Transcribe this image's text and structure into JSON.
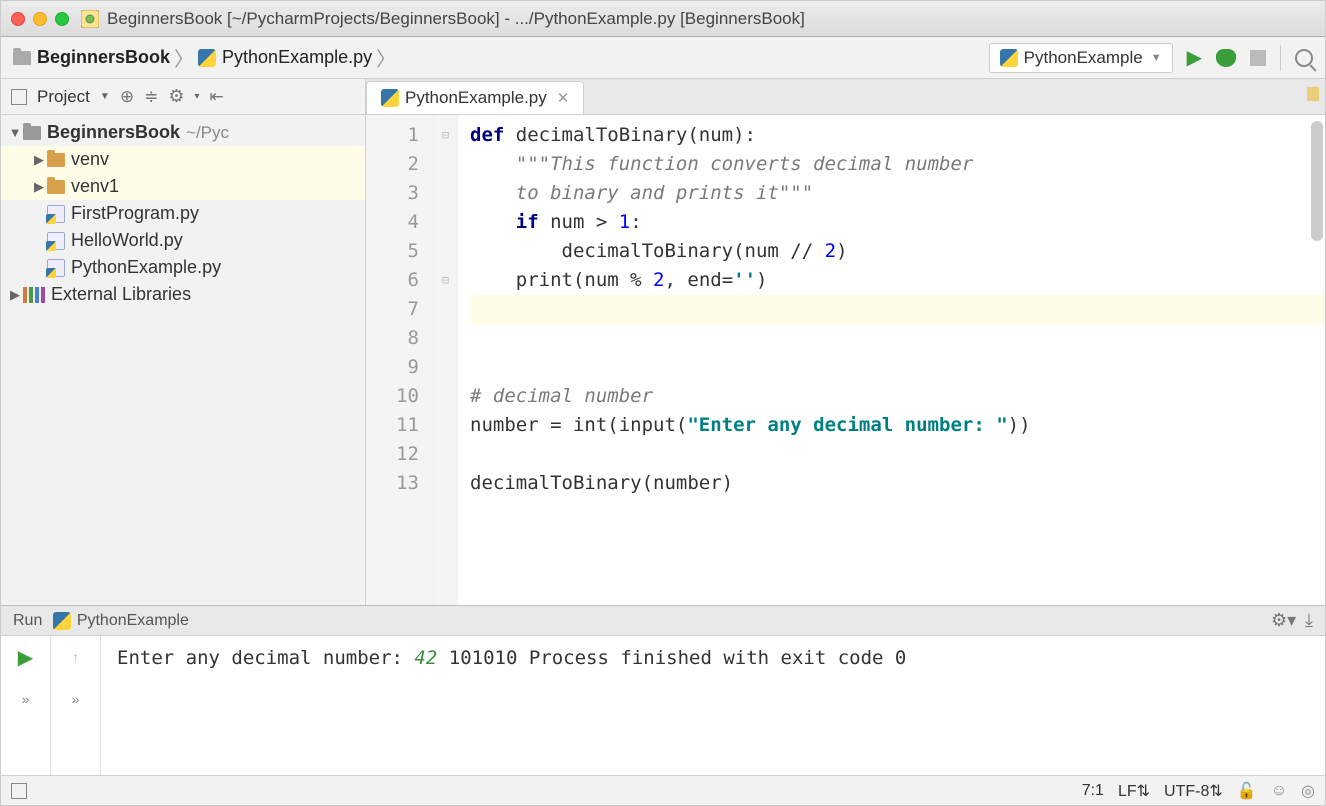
{
  "title": "BeginnersBook [~/PycharmProjects/BeginnersBook] - .../PythonExample.py [BeginnersBook]",
  "breadcrumb": {
    "root": "BeginnersBook",
    "file": "PythonExample.py"
  },
  "runConfig": "PythonExample",
  "sidebar": {
    "heading": "Project",
    "tree": {
      "project": "BeginnersBook",
      "projectPath": "~/Pyc",
      "venv0": "venv",
      "venv1": "venv1",
      "files": [
        "FirstProgram.py",
        "HelloWorld.py",
        "PythonExample.py"
      ],
      "extlib": "External Libraries"
    }
  },
  "editor": {
    "tab": "PythonExample.py",
    "lines": [
      "1",
      "2",
      "3",
      "4",
      "5",
      "6",
      "7",
      "8",
      "9",
      "10",
      "11",
      "12",
      "13"
    ],
    "code": {
      "l1_def": "def",
      "l1_name": " decimalToBinary(num):",
      "l2": "\"\"\"This function converts decimal number",
      "l3": "to binary and prints it\"\"\"",
      "l4_if": "if",
      "l4_cond": " num > ",
      "l4_one": "1",
      "l4_colon": ":",
      "l5_a": "decimalToBinary(num // ",
      "l5_two": "2",
      "l5_b": ")",
      "l6_a": "print(num % ",
      "l6_two": "2",
      "l6_b": ", end=",
      "l6_s": "''",
      "l6_c": ")",
      "l9": "# decimal number",
      "l10_a": "number = int(input(",
      "l10_s": "\"Enter any decimal number: \"",
      "l10_b": "))",
      "l12": "decimalToBinary(number)"
    }
  },
  "run": {
    "label": "Run",
    "name": "PythonExample",
    "out": {
      "prompt": "Enter any decimal number: ",
      "input": "42",
      "result": "101010",
      "exit": "Process finished with exit code 0"
    }
  },
  "status": {
    "pos": "7:1",
    "eol": "LF",
    "enc": "UTF-8"
  }
}
